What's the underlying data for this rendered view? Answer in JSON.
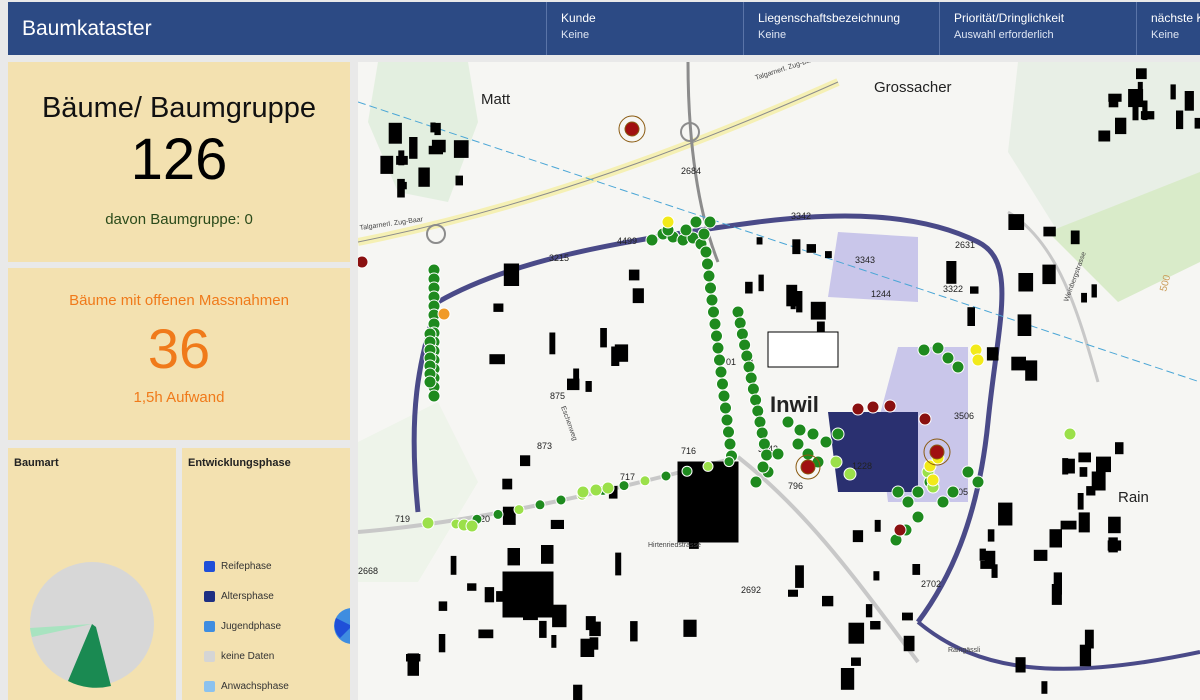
{
  "header": {
    "title": "Baumkataster",
    "filters": [
      {
        "label": "Kunde",
        "value": "Keine"
      },
      {
        "label": "Liegenschaftsbezeichnung",
        "value": "Keine"
      },
      {
        "label": "Priorität/Dringlichkeit",
        "value": "Auswahl erforderlich"
      },
      {
        "label": "nächste K",
        "value": "Keine"
      }
    ]
  },
  "stats": {
    "trees": {
      "title": "Bäume/ Baumgruppe",
      "value": "126",
      "subtitle": "davon Baumgruppe: 0"
    },
    "open_measures": {
      "title": "Bäume mit offenen Massnahmen",
      "value": "36",
      "subtitle": "1,5h Aufwand"
    }
  },
  "charts": {
    "baumart": {
      "title": "Baumart"
    },
    "entwicklung": {
      "title": "Entwicklungsphase",
      "legend": [
        {
          "label": "Reifephase",
          "color": "#1f4fd8"
        },
        {
          "label": "Altersphase",
          "color": "#1e2f82"
        },
        {
          "label": "Jugendphase",
          "color": "#3f8de0"
        },
        {
          "label": "keine Daten",
          "color": "#d5d5d5"
        },
        {
          "label": "Anwachsphase",
          "color": "#8cc2ee"
        }
      ]
    }
  },
  "map": {
    "places": [
      "Matt",
      "Grossacher",
      "Inwil",
      "Rain"
    ],
    "streets": [
      "Talgarnerl. Zug-Baar",
      "Talgarnerl. Zug-Baar",
      "Eschenweg",
      "Hirtenriedstrasse",
      "Weinbergstrasse",
      "Raingässli"
    ],
    "house_numbers": [
      "2684",
      "3342",
      "3343",
      "1244",
      "2631",
      "3322",
      "3215",
      "4499",
      "2701",
      "875",
      "873",
      "716",
      "717",
      "3443",
      "796",
      "1228",
      "3506",
      "3505",
      "720",
      "719",
      "2668",
      "2692",
      "2702"
    ],
    "contour": "500"
  }
}
